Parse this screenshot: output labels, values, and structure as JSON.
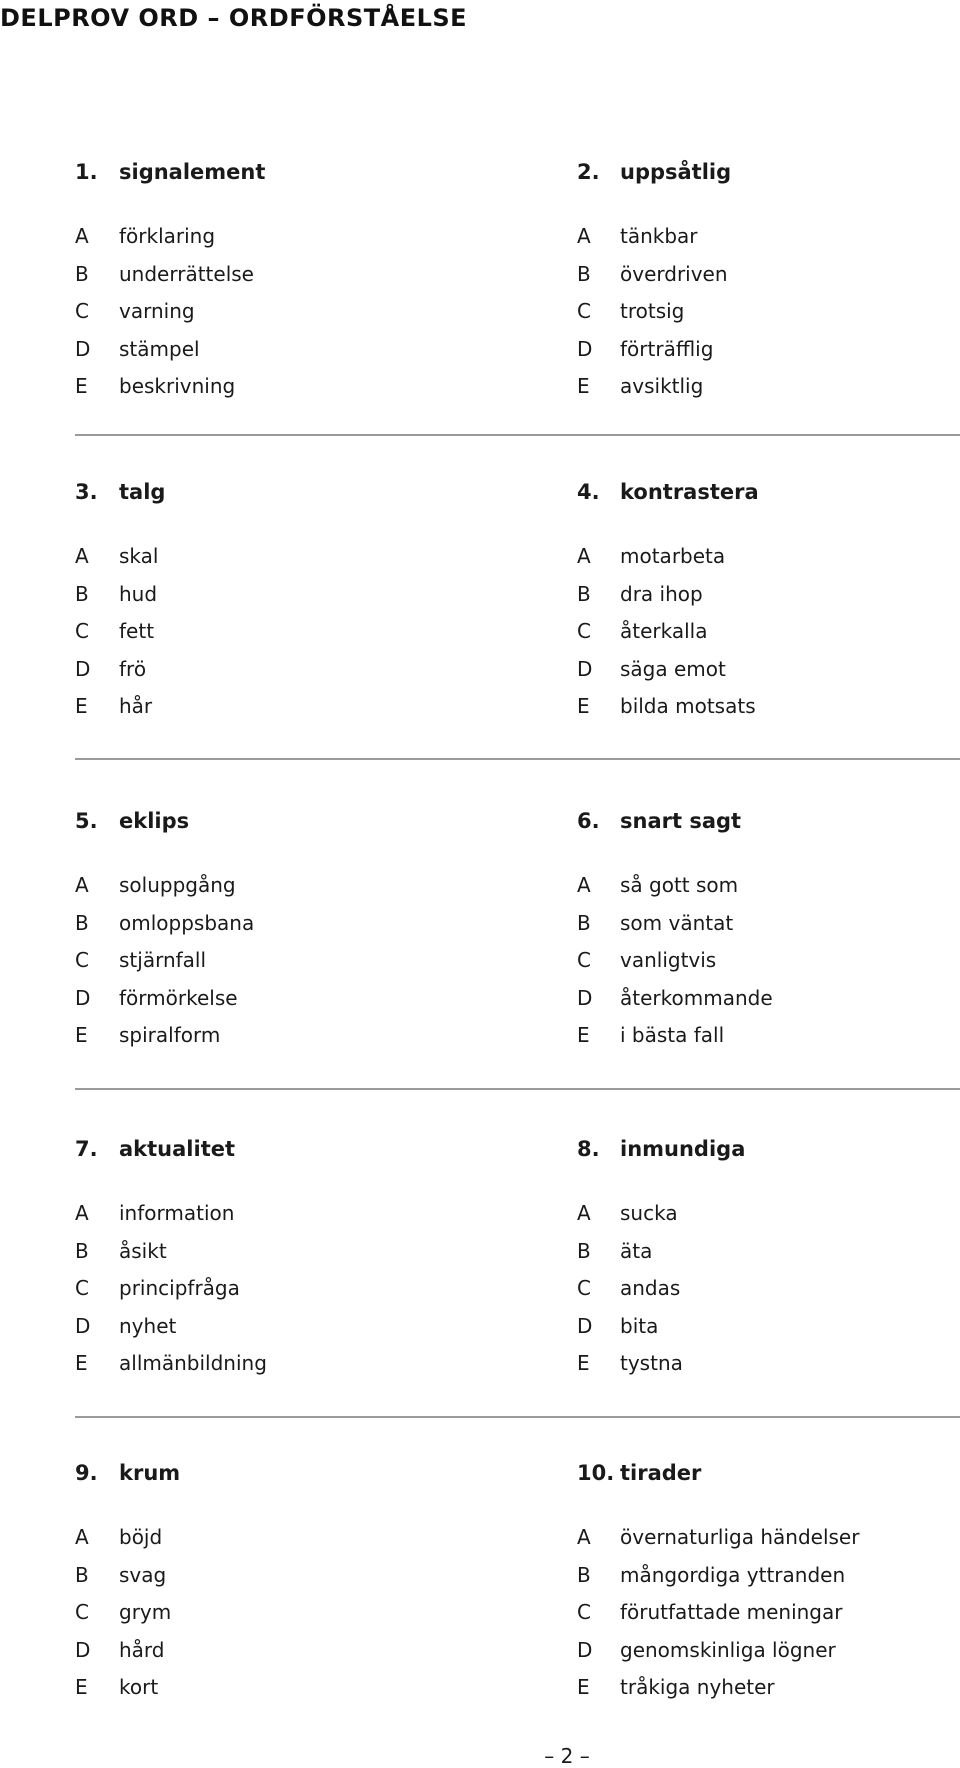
{
  "title": "DELPROV ORD – ORDFÖRSTÅELSE",
  "questions": [
    {
      "number": "1.",
      "word": "signalement",
      "options": [
        {
          "letter": "A",
          "text": "förklaring"
        },
        {
          "letter": "B",
          "text": "underrättelse"
        },
        {
          "letter": "C",
          "text": "varning"
        },
        {
          "letter": "D",
          "text": "stämpel"
        },
        {
          "letter": "E",
          "text": "beskrivning"
        }
      ]
    },
    {
      "number": "2.",
      "word": "uppsåtlig",
      "options": [
        {
          "letter": "A",
          "text": "tänkbar"
        },
        {
          "letter": "B",
          "text": "överdriven"
        },
        {
          "letter": "C",
          "text": "trotsig"
        },
        {
          "letter": "D",
          "text": "förträfflig"
        },
        {
          "letter": "E",
          "text": "avsiktlig"
        }
      ]
    },
    {
      "number": "3.",
      "word": "talg",
      "options": [
        {
          "letter": "A",
          "text": "skal"
        },
        {
          "letter": "B",
          "text": "hud"
        },
        {
          "letter": "C",
          "text": "fett"
        },
        {
          "letter": "D",
          "text": "frö"
        },
        {
          "letter": "E",
          "text": "hår"
        }
      ]
    },
    {
      "number": "4.",
      "word": "kontrastera",
      "options": [
        {
          "letter": "A",
          "text": "motarbeta"
        },
        {
          "letter": "B",
          "text": "dra ihop"
        },
        {
          "letter": "C",
          "text": "återkalla"
        },
        {
          "letter": "D",
          "text": "säga emot"
        },
        {
          "letter": "E",
          "text": "bilda motsats"
        }
      ]
    },
    {
      "number": "5.",
      "word": "eklips",
      "options": [
        {
          "letter": "A",
          "text": "soluppgång"
        },
        {
          "letter": "B",
          "text": "omloppsbana"
        },
        {
          "letter": "C",
          "text": "stjärnfall"
        },
        {
          "letter": "D",
          "text": "förmörkelse"
        },
        {
          "letter": "E",
          "text": "spiralform"
        }
      ]
    },
    {
      "number": "6.",
      "word": "snart sagt",
      "options": [
        {
          "letter": "A",
          "text": "så gott som"
        },
        {
          "letter": "B",
          "text": "som väntat"
        },
        {
          "letter": "C",
          "text": "vanligtvis"
        },
        {
          "letter": "D",
          "text": "återkommande"
        },
        {
          "letter": "E",
          "text": "i bästa fall"
        }
      ]
    },
    {
      "number": "7.",
      "word": "aktualitet",
      "options": [
        {
          "letter": "A",
          "text": "information"
        },
        {
          "letter": "B",
          "text": "åsikt"
        },
        {
          "letter": "C",
          "text": "principfråga"
        },
        {
          "letter": "D",
          "text": "nyhet"
        },
        {
          "letter": "E",
          "text": "allmänbildning"
        }
      ]
    },
    {
      "number": "8.",
      "word": "inmundiga",
      "options": [
        {
          "letter": "A",
          "text": "sucka"
        },
        {
          "letter": "B",
          "text": "äta"
        },
        {
          "letter": "C",
          "text": "andas"
        },
        {
          "letter": "D",
          "text": "bita"
        },
        {
          "letter": "E",
          "text": "tystna"
        }
      ]
    },
    {
      "number": "9.",
      "word": "krum",
      "options": [
        {
          "letter": "A",
          "text": "böjd"
        },
        {
          "letter": "B",
          "text": "svag"
        },
        {
          "letter": "C",
          "text": "grym"
        },
        {
          "letter": "D",
          "text": "hård"
        },
        {
          "letter": "E",
          "text": "kort"
        }
      ]
    },
    {
      "number": "10.",
      "word": "tirader",
      "options": [
        {
          "letter": "A",
          "text": "övernaturliga händelser"
        },
        {
          "letter": "B",
          "text": "mångordiga yttranden"
        },
        {
          "letter": "C",
          "text": "förutfattade meningar"
        },
        {
          "letter": "D",
          "text": "genomskinliga lögner"
        },
        {
          "letter": "E",
          "text": "tråkiga nyheter"
        }
      ]
    }
  ],
  "page_number": "– 2 –"
}
